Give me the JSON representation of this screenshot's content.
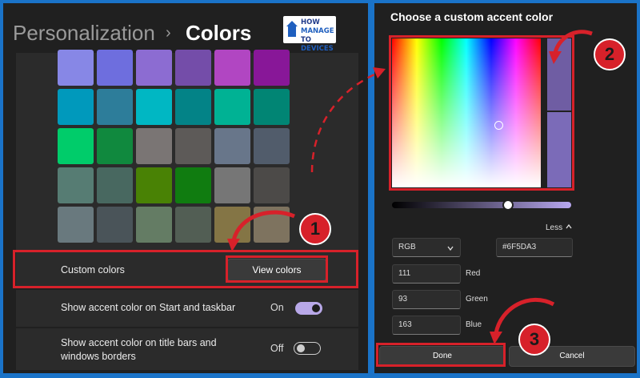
{
  "breadcrumb": {
    "parent": "Personalization",
    "separator": "›",
    "current": "Colors"
  },
  "logo": {
    "line1": "HOW",
    "line2": "TO",
    "line3": "MANAGE",
    "line4": "DEVICES"
  },
  "swatches": [
    [
      "#8787e6",
      "#6e6ede",
      "#8c6cd2",
      "#744da9",
      "#b146c2",
      "#881798"
    ],
    [
      "#0099bc",
      "#2d7d9a",
      "#00b7c3",
      "#038387",
      "#00b294",
      "#018574"
    ],
    [
      "#00cc6a",
      "#10893e",
      "#7a7574",
      "#5d5a58",
      "#68768a",
      "#515c6b"
    ],
    [
      "#567c73",
      "#486860",
      "#498205",
      "#107c10",
      "#767676",
      "#4c4a48"
    ],
    [
      "#69797e",
      "#4a5459",
      "#647c64",
      "#525e54",
      "#847545",
      "#7e735f"
    ]
  ],
  "custom_colors": {
    "label": "Custom colors",
    "button": "View colors"
  },
  "start_taskbar": {
    "label": "Show accent color on Start and taskbar",
    "state": "On"
  },
  "title_bars": {
    "label_line1": "Show accent color on title bars and",
    "label_line2": "windows borders",
    "state": "Off"
  },
  "picker": {
    "title": "Choose a custom accent color",
    "less": "Less",
    "model": "RGB",
    "hex": "#6F5DA3",
    "red": "111",
    "red_label": "Red",
    "green": "93",
    "green_label": "Green",
    "blue": "163",
    "blue_label": "Blue",
    "done": "Done",
    "cancel": "Cancel",
    "selected_color": "#6f5da3"
  },
  "badges": {
    "one": "1",
    "two": "2",
    "three": "3"
  },
  "colors": {
    "annotation_red": "#d7212a",
    "toggle_on": "#b8a8e8",
    "frame_blue": "#1a73c8"
  }
}
